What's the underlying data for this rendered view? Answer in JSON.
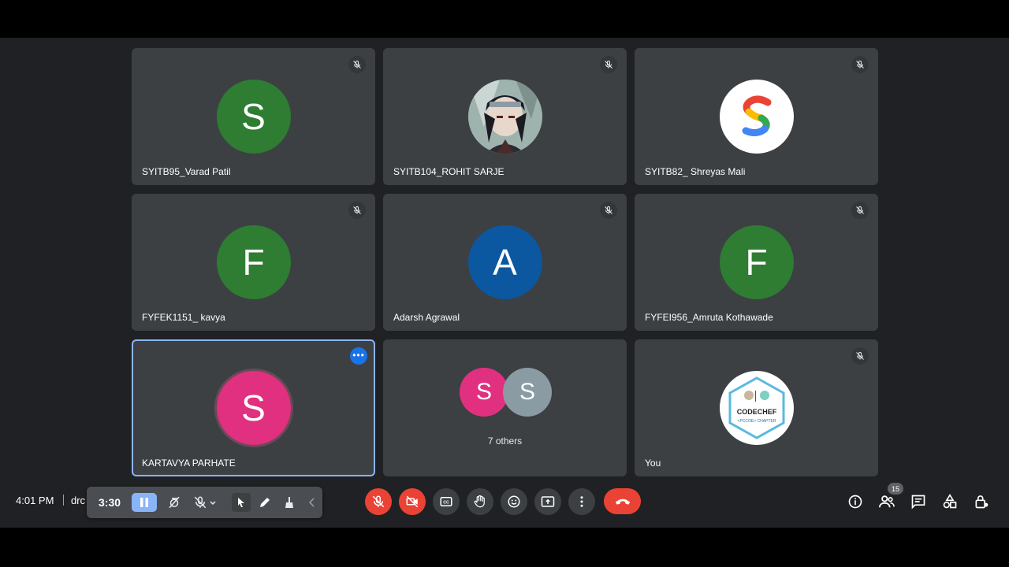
{
  "tiles": [
    {
      "name": "SYITB95_Varad Patil",
      "initial": "S",
      "avatar_color": "#2e7d32",
      "muted": true
    },
    {
      "name": "SYITB104_ROHIT SARJE",
      "initial": "",
      "avatar": "anime-portrait",
      "muted": true
    },
    {
      "name": "SYITB82_ Shreyas Mali",
      "initial": "",
      "avatar": "google-s-logo",
      "muted": true
    },
    {
      "name": "FYFEK1151_ kavya",
      "initial": "F",
      "avatar_color": "#2e7d32",
      "muted": true
    },
    {
      "name": "Adarsh Agrawal",
      "initial": "A",
      "avatar_color": "#0b57a0",
      "muted": true
    },
    {
      "name": "FYFEI956_Amruta Kothawade",
      "initial": "F",
      "avatar_color": "#2e7d32",
      "muted": true
    },
    {
      "name": "KARTAVYA PARHATE",
      "initial": "S",
      "avatar_color": "#e0307f",
      "active": true
    },
    {
      "others_label": "7 others",
      "stack": [
        {
          "initial": "S",
          "color": "#e0307f"
        },
        {
          "initial": "S",
          "color": "#8a9ba3"
        }
      ]
    },
    {
      "name": "You",
      "avatar": "codechef-logo",
      "logo_text": "CODECHEF",
      "logo_sub": "<PCCOE> CHAPTER",
      "muted": true
    }
  ],
  "bottom": {
    "clock": "4:01 PM",
    "meeting_code": "drc",
    "annotation_timer": "3:30",
    "people_count": "15"
  },
  "colors": {
    "stage": "#202124",
    "tile": "#3c4043",
    "accent": "#8ab4f8",
    "danger": "#ea4335"
  }
}
